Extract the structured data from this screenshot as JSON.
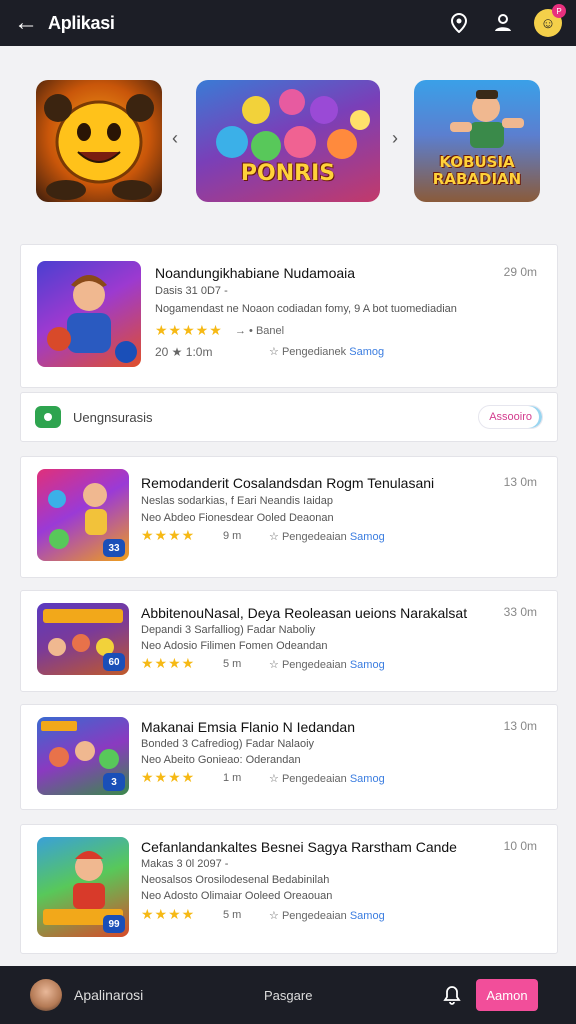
{
  "header": {
    "title": "Aplikasi"
  },
  "carousel": {
    "banners": [
      {
        "title": ""
      },
      {
        "title": "PONRIS"
      },
      {
        "title": "KOBUSIA RABADIAN"
      }
    ]
  },
  "featured": {
    "name": "Noandungikhabiane Nudamoaia",
    "meta1": "Dasis 31 0D7 -",
    "meta2": "Nogamendast ne Noaon codiadan fomy, 9 A bot tuomediadian",
    "stars": "★★★★★",
    "sub1": "→ • Banel",
    "size": "20 ★ 1:0m",
    "category": "Pengedianek",
    "link": "Samog",
    "time": "29 0m"
  },
  "promo": {
    "label": "Uengnsurasis",
    "button": "Assooiro"
  },
  "apps": [
    {
      "name": "Remodanderit Cosalandsdan Rogm Tenulasani",
      "meta1": "Neslas sodarkias, f Eari Neandis Iaidap",
      "meta2": "Neo Abdeo Fionesdear Ooled Deaonan",
      "stars": "★★★★",
      "size": "9 m",
      "category": "Pengedeaian",
      "link": "Samog",
      "time": "13 0m",
      "badge": "33"
    },
    {
      "name": "AbbitenouNasal, Deya Reoleasan ueions Narakalsat",
      "meta1": "Depandi 3 Sarfalliog) Fadar Naboliy",
      "meta2": "Neo Adosio Filimen Fomen Odeandan",
      "stars": "★★★★",
      "size": "5 m",
      "category": "Pengedeaian",
      "link": "Samog",
      "time": "33 0m",
      "badge": "60"
    },
    {
      "name": "Makanai Emsia Flanio N Iedandan",
      "meta1": "Bonded 3 Cafrediog) Fadar Nalaoiy",
      "meta2": "Neo Abeito Gonieao: Oderandan",
      "stars": "★★★★",
      "size": "1 m",
      "category": "Pengedeaian",
      "link": "Samog",
      "time": "13 0m",
      "badge": "3"
    },
    {
      "name": "Cefanlandankaltes Besnei Sagya Rarstham Cande",
      "meta1": "Makas 3 0l 2097 -",
      "meta2": "Neosalsos Orosilodesenal Bedabinilah",
      "meta3": "Neo Adosto Olimaiar Ooleed Oreaouan",
      "stars": "★★★★",
      "size": "5 m",
      "category": "Pengedeaian",
      "link": "Samog",
      "time": "10 0m",
      "badge": "99"
    }
  ],
  "bottom": {
    "label": "Apalinarosi",
    "center": "Pasgare",
    "button": "Aamon"
  }
}
